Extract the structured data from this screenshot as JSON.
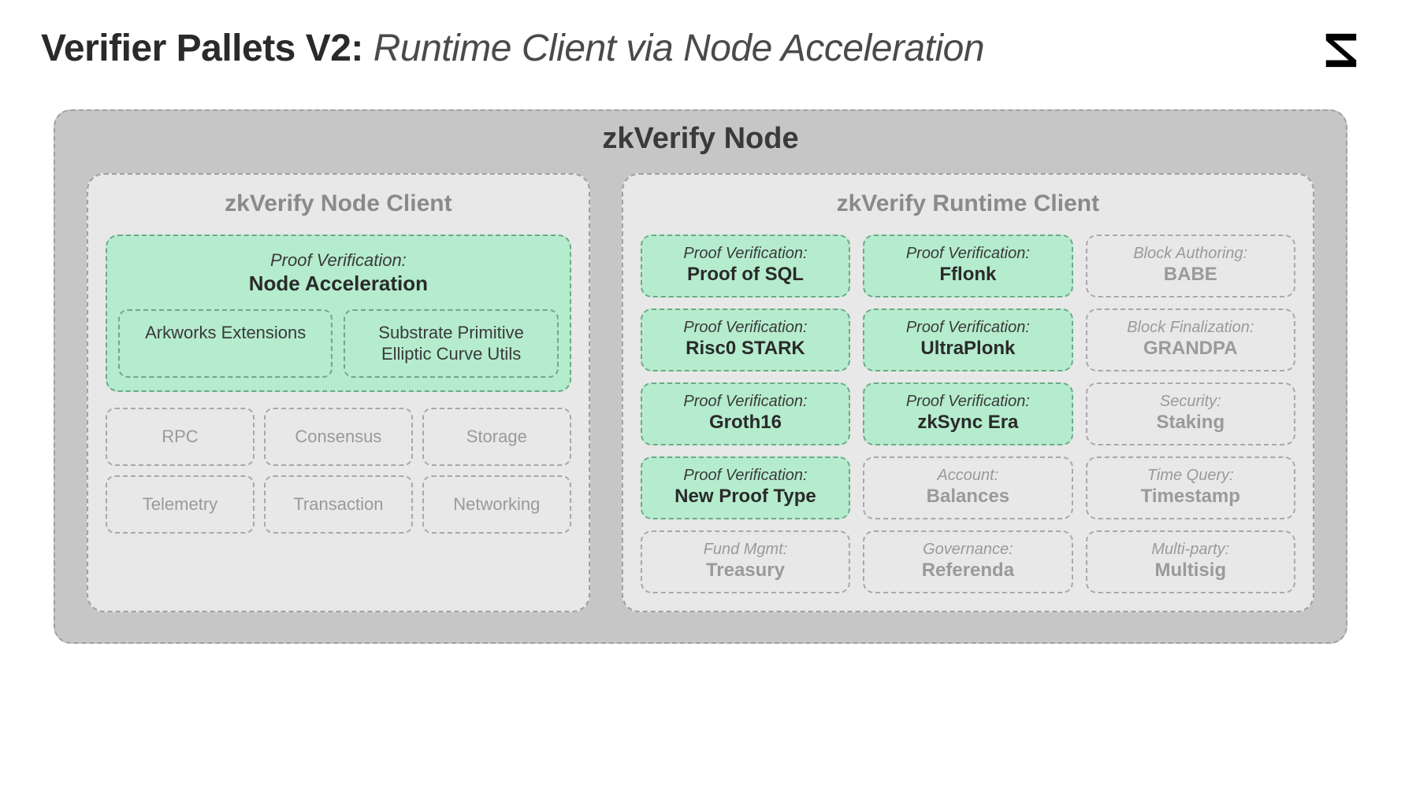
{
  "title": {
    "bold": "Verifier Pallets V2:",
    "italic": "Runtime Client via Node Acceleration"
  },
  "node": {
    "title": "zkVerify Node",
    "left": {
      "title": "zkVerify Node Client",
      "accel": {
        "pre": "Proof Verification:",
        "main": "Node Acceleration",
        "subs": [
          "Arkworks Extensions",
          "Substrate Primitive Elliptic Curve Utils"
        ]
      },
      "grey": [
        "RPC",
        "Consensus",
        "Storage",
        "Telemetry",
        "Transaction",
        "Networking"
      ]
    },
    "right": {
      "title": "zkVerify Runtime Client",
      "cells": [
        {
          "pre": "Proof Verification:",
          "main": "Proof of SQL",
          "variant": "green"
        },
        {
          "pre": "Proof Verification:",
          "main": "Fflonk",
          "variant": "green"
        },
        {
          "pre": "Block Authoring:",
          "main": "BABE",
          "variant": "grey"
        },
        {
          "pre": "Proof Verification:",
          "main": "Risc0 STARK",
          "variant": "green"
        },
        {
          "pre": "Proof Verification:",
          "main": "UltraPlonk",
          "variant": "green"
        },
        {
          "pre": "Block Finalization:",
          "main": "GRANDPA",
          "variant": "grey"
        },
        {
          "pre": "Proof Verification:",
          "main": "Groth16",
          "variant": "green"
        },
        {
          "pre": "Proof Verification:",
          "main": "zkSync Era",
          "variant": "green"
        },
        {
          "pre": "Security:",
          "main": "Staking",
          "variant": "grey"
        },
        {
          "pre": "Proof Verification:",
          "main": "New Proof Type",
          "variant": "green"
        },
        {
          "pre": "Account:",
          "main": "Balances",
          "variant": "grey"
        },
        {
          "pre": "Time Query:",
          "main": "Timestamp",
          "variant": "grey"
        },
        {
          "pre": "Fund Mgmt:",
          "main": "Treasury",
          "variant": "grey"
        },
        {
          "pre": "Governance:",
          "main": "Referenda",
          "variant": "grey"
        },
        {
          "pre": "Multi-party:",
          "main": "Multisig",
          "variant": "grey"
        }
      ]
    }
  }
}
